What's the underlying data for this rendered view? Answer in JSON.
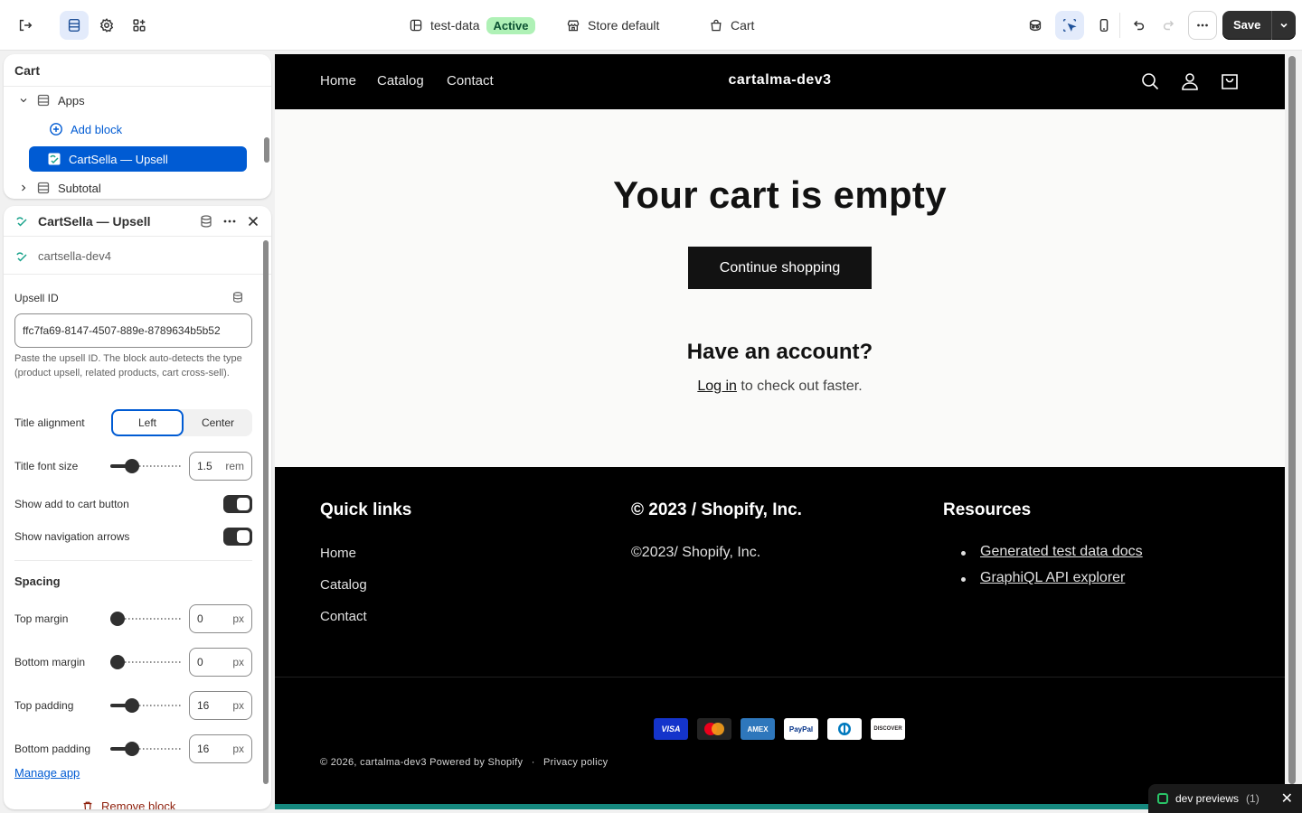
{
  "topbar": {
    "theme_name": "test-data",
    "theme_status": "Active",
    "context_label": "Store default",
    "page_label": "Cart",
    "save_label": "Save"
  },
  "tree": {
    "title": "Cart",
    "items": [
      {
        "label": "Apps"
      },
      {
        "label": "Add block"
      },
      {
        "label": "CartSella — Upsell"
      },
      {
        "label": "Subtotal"
      }
    ]
  },
  "settings": {
    "title": "CartSella — Upsell",
    "app_name": "cartsella-dev4",
    "upsell_label": "Upsell ID",
    "upsell_value": "ffc7fa69-8147-4507-889e-8789634b5b52",
    "upsell_help": "Paste the upsell ID. The block auto-detects the type (product upsell, related products, cart cross-sell).",
    "alignment_label": "Title alignment",
    "alignment_options": [
      "Left",
      "Center"
    ],
    "alignment_selected": "Left",
    "font_size_label": "Title font size",
    "font_size_value": "1.5",
    "font_size_unit": "rem",
    "font_size_level": 0.25,
    "show_cart_label": "Show add to cart button",
    "show_cart_on": true,
    "show_arrows_label": "Show navigation arrows",
    "show_arrows_on": true,
    "spacing_title": "Spacing",
    "spacing": [
      {
        "label": "Top margin",
        "value": "0",
        "unit": "px",
        "level": 0
      },
      {
        "label": "Bottom margin",
        "value": "0",
        "unit": "px",
        "level": 0
      },
      {
        "label": "Top padding",
        "value": "16",
        "unit": "px",
        "level": 0.25
      },
      {
        "label": "Bottom padding",
        "value": "16",
        "unit": "px",
        "level": 0.25
      }
    ],
    "manage_app": "Manage app",
    "remove_block": "Remove block"
  },
  "store": {
    "nav": [
      "Home",
      "Catalog",
      "Contact"
    ],
    "brand": "cartalma-dev3",
    "empty_title": "Your cart is empty",
    "cta": "Continue shopping",
    "account_title": "Have an account?",
    "login_link": "Log in",
    "login_suffix": " to check out faster.",
    "footer": {
      "quick_links_title": "Quick links",
      "quick_links": [
        "Home",
        "Catalog",
        "Contact"
      ],
      "company_title": "© 2023 / Shopify, Inc.",
      "company_text": "©2023/ Shopify, Inc.",
      "resources_title": "Resources",
      "resources": [
        "Generated test data docs",
        "GraphiQL API explorer"
      ],
      "payments": [
        "VISA",
        "mastercard",
        "AMEX",
        "PayPal",
        "Diners",
        "DISCOVER"
      ],
      "copyright": "© 2026, cartalma-dev3 Powered by Shopify",
      "separator": "·",
      "privacy": "Privacy policy"
    }
  },
  "toast": {
    "label": "dev previews",
    "count": "(1)"
  },
  "colors": {
    "accent": "#005bd3",
    "badge_bg": "#aff1b6",
    "store_bg": "#000000"
  }
}
